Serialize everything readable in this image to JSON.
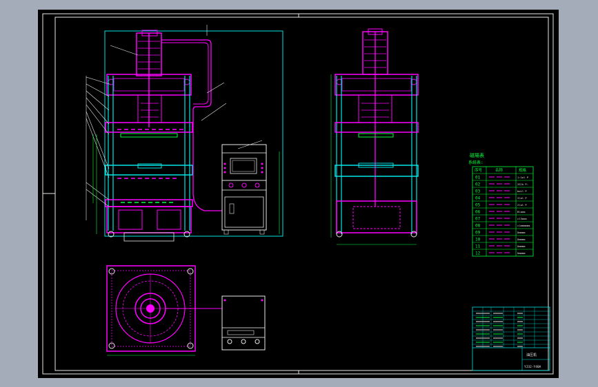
{
  "colors": {
    "background": "#a3acb8",
    "sheet": "#000000",
    "frame": "#eaeaea",
    "cyan": "#00e5e5",
    "magenta": "#ff00ff",
    "green": "#00ff3c",
    "white": "#ffffff",
    "yellow": "#ffff00"
  },
  "legend": {
    "title": "磁場表",
    "subtitle": "系统表:",
    "header_no": "序号",
    "header_name": "名称",
    "header_spec": "规格",
    "rows": [
      {
        "no": "01",
        "spec": "1:1ol P"
      },
      {
        "no": "02",
        "spec": "2Slh P:"
      },
      {
        "no": "03",
        "spec": "boil P"
      },
      {
        "no": "04",
        "spec": "3lol P"
      },
      {
        "no": "05",
        "spec": "2lol P"
      },
      {
        "no": "06",
        "spec": "Blaom"
      },
      {
        "no": "07",
        "spec": "cl3aom"
      },
      {
        "no": "08",
        "spec": "clmmmmmm"
      },
      {
        "no": "09",
        "spec": "Ommmm"
      },
      {
        "no": "10",
        "spec": "Ommmm"
      },
      {
        "no": "11",
        "spec": "Ommmm"
      },
      {
        "no": "12",
        "spec": "Ommmm"
      }
    ]
  },
  "title_block": {
    "label_a": "油压机",
    "label_b": "YJ32-Y40A"
  }
}
